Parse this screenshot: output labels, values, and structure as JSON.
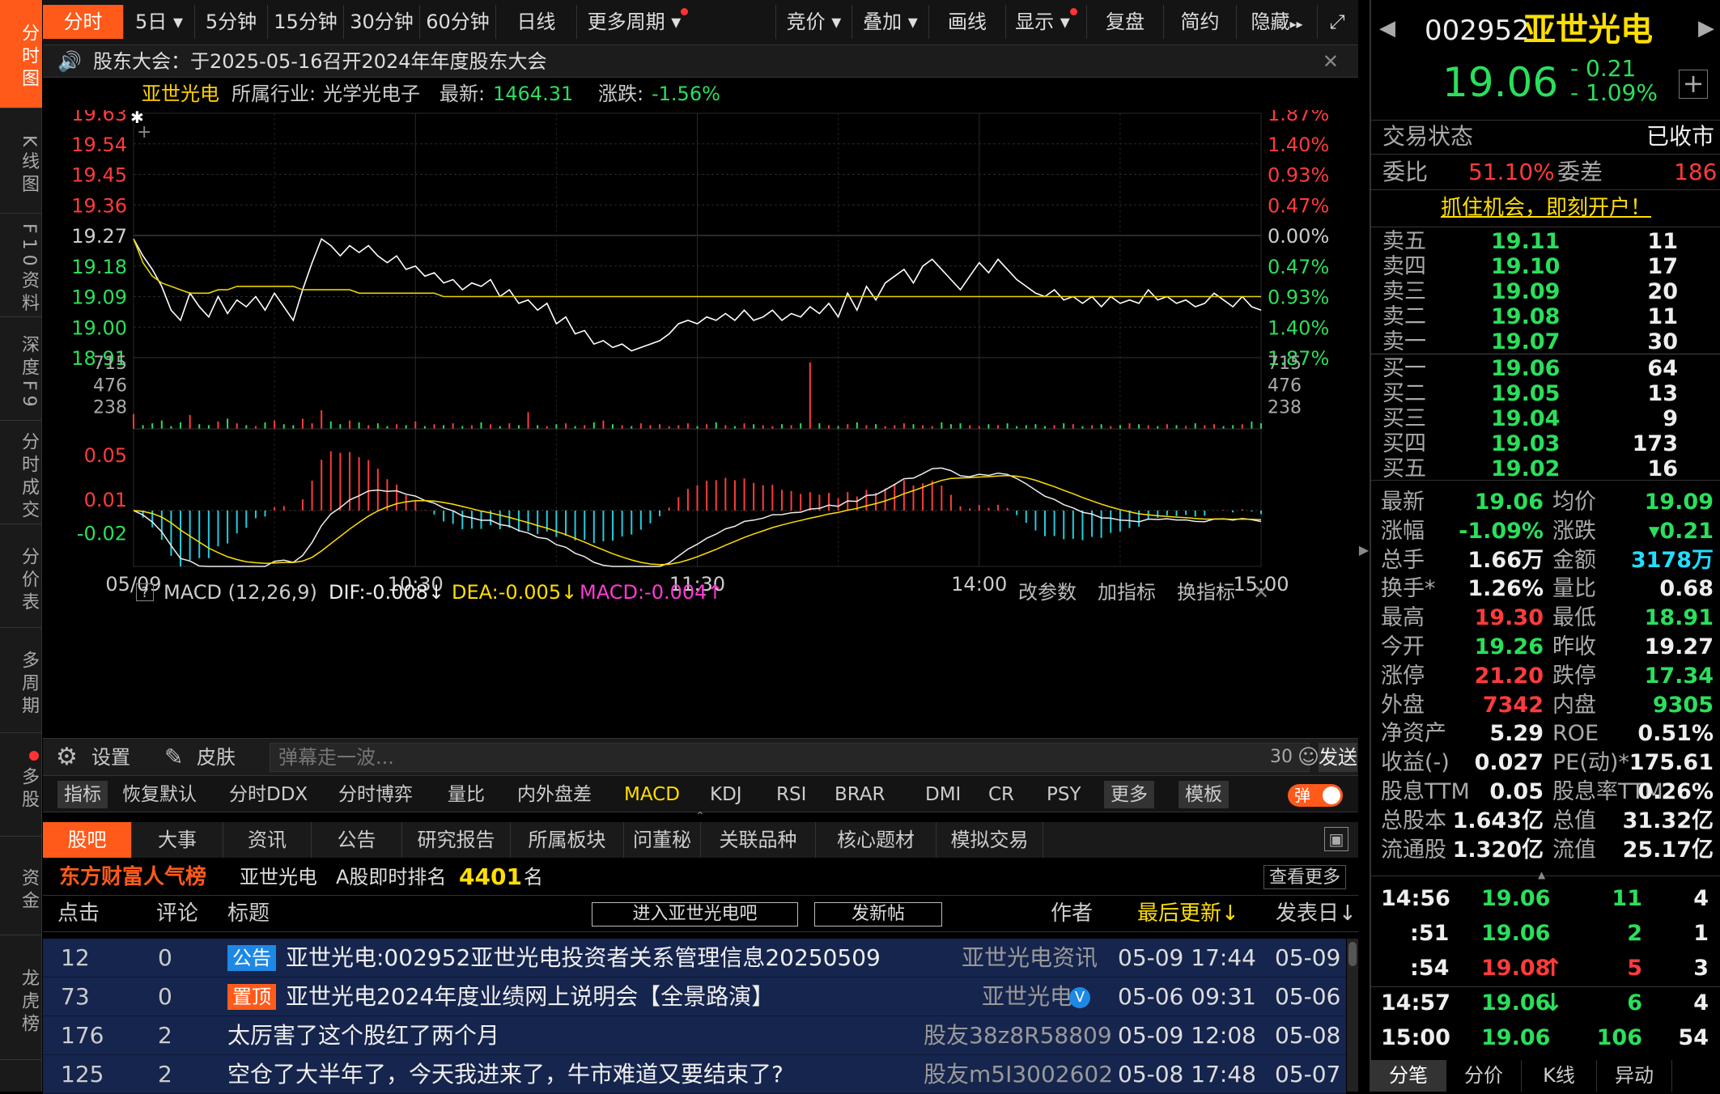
{
  "leftnav": [
    {
      "label": "分时图"
    },
    {
      "label": "K线图"
    },
    {
      "label": "F10资料"
    },
    {
      "label": "深度F9"
    },
    {
      "label": "分时成交"
    },
    {
      "label": "分价表"
    },
    {
      "label": "多周期"
    },
    {
      "label": "多股"
    },
    {
      "label": "资金"
    },
    {
      "label": "龙虎榜"
    }
  ],
  "toptabs": [
    "分时",
    "5日",
    "5分钟",
    "15分钟",
    "30分钟",
    "60分钟",
    "日线",
    "更多周期"
  ],
  "tools": [
    "竞价",
    "叠加",
    "画线",
    "显示",
    "复盘",
    "简约",
    "隐藏"
  ],
  "tool_icons": {
    "tabs_expand": "▾",
    "hide_arrow": "▸▸",
    "fullscreen": "⤢",
    "notice": "🔊",
    "close": "✕",
    "prev": "◀",
    "next": "▶",
    "add": "+",
    "help": "?",
    "gear": "⚙",
    "skin": "✎",
    "danmaku": "☺",
    "drag": "⌃",
    "collapse": "▶",
    "settings_box": "▣",
    "scroll": "▲",
    "dot": "●"
  },
  "notice": "股东大会：于2025-05-16召开2024年年度股东大会",
  "chart_header": {
    "name": "亚世光电",
    "industry_label": "所属行业:",
    "industry": "光学光电子",
    "latest_label": "最新:",
    "latest": "1464.31",
    "change_label": "涨跌:",
    "change": "-1.56%"
  },
  "macd_header": {
    "help": "?",
    "title": "MACD (12,26,9)",
    "dif": "DIF:-0.008↓",
    "dea": "DEA:-0.005↓",
    "macd": "MACD:-0.004↑",
    "b1": "改参数",
    "b2": "加指标",
    "b3": "换指标"
  },
  "bottombar": {
    "settings": "设置",
    "skin": "皮肤",
    "placeholder": "弹幕走一波...",
    "count": "30",
    "send": "发送"
  },
  "indicator_tabs": [
    "指标",
    "恢复默认",
    "分时DDX",
    "分时博弈",
    "量比",
    "内外盘差",
    "MACD",
    "KDJ",
    "RSI",
    "BRAR",
    "DMI",
    "CR",
    "PSY",
    "更多",
    "模板"
  ],
  "danmaku_toggle": "弹",
  "news_tabs": [
    "股吧",
    "大事",
    "资讯",
    "公告",
    "研究报告",
    "所属板块",
    "问董秘",
    "关联品种",
    "核心题材",
    "模拟交易"
  ],
  "rank": {
    "brand": "东方财富人气榜",
    "stock": "亚世光电",
    "label": "A股即时排名",
    "value": "4401",
    "unit": "名",
    "more": "查看更多"
  },
  "list_header": {
    "clicks": "点击",
    "comments": "评论",
    "title": "标题",
    "enter": "进入亚世光电吧",
    "post": "发新帖",
    "author": "作者",
    "updated": "最后更新↓",
    "published": "发表日↓"
  },
  "posts": [
    {
      "clicks": "12",
      "comments": "0",
      "tag": "公告",
      "tag_color": "#1e88e5",
      "title": "亚世光电:002952亚世光电投资者关系管理信息20250509",
      "author": "亚世光电资讯",
      "updated": "05-09 17:44",
      "published": "05-09"
    },
    {
      "clicks": "73",
      "comments": "0",
      "tag": "置顶",
      "tag_color": "#ff5a1a",
      "title": "亚世光电2024年度业绩网上说明会【全景路演】",
      "author": "亚世光电",
      "verified": "V",
      "updated": "05-06 09:31",
      "published": "05-06"
    },
    {
      "clicks": "176",
      "comments": "2",
      "tag": "",
      "title": "太厉害了这个股红了两个月",
      "author": "股友38z8R58809",
      "updated": "05-09 12:08",
      "published": "05-08"
    },
    {
      "clicks": "125",
      "comments": "2",
      "tag": "",
      "title": "空仓了大半年了，今天我进来了，牛市难道又要结束了?",
      "author": "股友m5I3002602",
      "updated": "05-08 17:48",
      "published": "05-07"
    }
  ],
  "quote": {
    "code": "002952",
    "name": "亚世光电",
    "price": "19.06",
    "chg": "- 0.21",
    "pct": "- 1.09%"
  },
  "status": {
    "label": "交易状态",
    "value": "已收市",
    "wb_label": "委比",
    "wb": "51.10%",
    "wc_label": "委差",
    "wc": "186",
    "promo": "抓住机会，即刻开户！"
  },
  "orderbook": [
    {
      "label": "卖五",
      "price": "19.11",
      "vol": "11"
    },
    {
      "label": "卖四",
      "price": "19.10",
      "vol": "17"
    },
    {
      "label": "卖三",
      "price": "19.09",
      "vol": "20"
    },
    {
      "label": "卖二",
      "price": "19.08",
      "vol": "11"
    },
    {
      "label": "卖一",
      "price": "19.07",
      "vol": "30"
    },
    {
      "label": "买一",
      "price": "19.06",
      "vol": "64"
    },
    {
      "label": "买二",
      "price": "19.05",
      "vol": "13"
    },
    {
      "label": "买三",
      "price": "19.04",
      "vol": "9"
    },
    {
      "label": "买四",
      "price": "19.03",
      "vol": "173"
    },
    {
      "label": "买五",
      "price": "19.02",
      "vol": "16"
    }
  ],
  "stats": [
    {
      "l1": "最新",
      "v1": "19.06",
      "c1": "green",
      "l2": "均价",
      "v2": "19.09",
      "c2": "green"
    },
    {
      "l1": "涨幅",
      "v1": "-1.09%",
      "c1": "green",
      "l2": "涨跌",
      "v2": "▾0.21",
      "c2": "green"
    },
    {
      "l1": "总手",
      "v1": "1.66万",
      "c1": "white",
      "l2": "金额",
      "v2": "3178万",
      "c2": "cyan"
    },
    {
      "l1": "换手*",
      "v1": "1.26%",
      "c1": "white",
      "l2": "量比",
      "v2": "0.68",
      "c2": "white"
    },
    {
      "l1": "最高",
      "v1": "19.30",
      "c1": "red",
      "l2": "最低",
      "v2": "18.91",
      "c2": "green"
    },
    {
      "l1": "今开",
      "v1": "19.26",
      "c1": "green",
      "l2": "昨收",
      "v2": "19.27",
      "c2": "white"
    },
    {
      "l1": "涨停",
      "v1": "21.20",
      "c1": "red",
      "l2": "跌停",
      "v2": "17.34",
      "c2": "green"
    },
    {
      "l1": "外盘",
      "v1": "7342",
      "c1": "red",
      "l2": "内盘",
      "v2": "9305",
      "c2": "green"
    },
    {
      "l1": "净资产",
      "v1": "5.29",
      "c1": "white",
      "l2": "ROE",
      "v2": "0.51%",
      "c2": "white"
    },
    {
      "l1": "收益(-)",
      "v1": "0.027",
      "c1": "white",
      "l2": "PE(动)*",
      "v2": "175.61",
      "c2": "white"
    },
    {
      "l1": "股息TTM",
      "v1": "0.05",
      "c1": "white",
      "l2": "股息率TTM",
      "v2": "0.26%",
      "c2": "white"
    },
    {
      "l1": "总股本",
      "v1": "1.643亿",
      "c1": "white",
      "l2": "总值",
      "v2": "31.32亿",
      "c2": "white"
    },
    {
      "l1": "流通股",
      "v1": "1.320亿",
      "c1": "white",
      "l2": "流值",
      "v2": "25.17亿",
      "c2": "white"
    }
  ],
  "ticks": [
    {
      "time": "14:56",
      "price": "19.06",
      "arrow": "",
      "vol": "11",
      "num": "4",
      "volcolor": "green"
    },
    {
      "time": ":51",
      "price": "19.06",
      "arrow": "",
      "vol": "2",
      "num": "1",
      "volcolor": "green"
    },
    {
      "time": ":54",
      "price": "19.08",
      "arrow": "↑",
      "vol": "5",
      "num": "3",
      "volcolor": "red"
    },
    {
      "time": "14:57",
      "price": "19.06",
      "arrow": "↓",
      "vol": "6",
      "num": "4",
      "volcolor": "green"
    },
    {
      "time": "15:00",
      "price": "19.06",
      "arrow": "",
      "vol": "106",
      "num": "54",
      "volcolor": "green"
    }
  ],
  "bottom_tabs": [
    "分笔",
    "分价",
    "K线",
    "异动"
  ],
  "chart_data": {
    "type": "line",
    "title": "",
    "x_ticks": [
      "05/09",
      "10:30",
      "11:30",
      "14:00",
      "15:00"
    ],
    "y_ticks": [
      "19.63",
      "19.54",
      "19.45",
      "19.36",
      "19.27",
      "19.18",
      "19.09",
      "19.00",
      "18.91"
    ],
    "y_ticks_pct": [
      "1.87%",
      "1.40%",
      "0.93%",
      "0.47%",
      "0.00%",
      "0.47%",
      "0.93%",
      "1.40%",
      "1.87%"
    ],
    "ylim": [
      18.91,
      19.63
    ],
    "prev_close": 19.27,
    "series": [
      {
        "values": [
          19.26,
          19.21,
          19.17,
          19.12,
          19.05,
          19.02,
          19.1,
          19.06,
          19.03,
          19.09,
          19.04,
          19.08,
          19.06,
          19.09,
          19.05,
          19.1,
          19.06,
          19.02,
          19.11,
          19.19,
          19.26,
          19.24,
          19.21,
          19.24,
          19.22,
          19.24,
          19.21,
          19.19,
          19.21,
          19.17,
          19.18,
          19.15,
          19.16,
          19.13,
          19.14,
          19.11,
          19.13,
          19.12,
          19.14,
          19.09,
          19.11,
          19.07,
          19.08,
          19.05,
          19.07,
          19.01,
          19.03,
          18.98,
          18.99,
          18.95,
          18.96,
          18.94,
          18.95,
          18.93,
          18.94,
          18.95,
          18.96,
          18.98,
          19.01,
          19.02,
          19.01,
          19.03,
          19.02,
          19.04,
          19.02,
          19.05,
          19.02,
          19.03,
          19.05,
          19.02,
          19.04,
          19.03,
          19.06,
          19.04,
          19.07,
          19.03,
          19.1,
          19.05,
          19.12,
          19.08,
          19.13,
          19.15,
          19.17,
          19.13,
          19.18,
          19.2,
          19.17,
          19.14,
          19.11,
          19.15,
          19.19,
          19.16,
          19.2,
          19.17,
          19.14,
          19.12,
          19.1,
          19.09,
          19.11,
          19.08,
          19.09,
          19.07,
          19.09,
          19.06,
          19.09,
          19.07,
          19.08,
          19.07,
          19.11,
          19.08,
          19.09,
          19.07,
          19.08,
          19.06,
          19.07,
          19.1,
          19.08,
          19.06,
          19.09,
          19.06,
          19.05
        ],
        "color": "#ffffff"
      },
      {
        "values": [
          19.26,
          19.19,
          19.15,
          19.13,
          19.12,
          19.11,
          19.1,
          19.1,
          19.1,
          19.11,
          19.11,
          19.12,
          19.12,
          19.12,
          19.12,
          19.12,
          19.12,
          19.12,
          19.11,
          19.11,
          19.11,
          19.11,
          19.11,
          19.11,
          19.1,
          19.1,
          19.1,
          19.1,
          19.1,
          19.1,
          19.1,
          19.1,
          19.1,
          19.09,
          19.09,
          19.09,
          19.09,
          19.09,
          19.09,
          19.09,
          19.09,
          19.09,
          19.09,
          19.09,
          19.09,
          19.09,
          19.09,
          19.09,
          19.09,
          19.09,
          19.09,
          19.09,
          19.09,
          19.09,
          19.09,
          19.09,
          19.09,
          19.09,
          19.09,
          19.09,
          19.09,
          19.09,
          19.09,
          19.09,
          19.09,
          19.09,
          19.09,
          19.09,
          19.09,
          19.09,
          19.09,
          19.09,
          19.09,
          19.09,
          19.09,
          19.09,
          19.09,
          19.09,
          19.09,
          19.09,
          19.09,
          19.09,
          19.09,
          19.09,
          19.09,
          19.09,
          19.09,
          19.09,
          19.09,
          19.09,
          19.09,
          19.09,
          19.09,
          19.09,
          19.09,
          19.09,
          19.09,
          19.09,
          19.09,
          19.09,
          19.09,
          19.09,
          19.09,
          19.09,
          19.09,
          19.09,
          19.09,
          19.09,
          19.09,
          19.09,
          19.09,
          19.09,
          19.09,
          19.09,
          19.09,
          19.09,
          19.09,
          19.09,
          19.09,
          19.09,
          19.09
        ],
        "color": "#e6d300"
      }
    ],
    "volume_ticks": [
      "715",
      "476",
      "238"
    ],
    "volume": [
      160,
      40,
      60,
      90,
      30,
      70,
      150,
      50,
      40,
      80,
      110,
      60,
      40,
      30,
      70,
      90,
      50,
      40,
      110,
      60,
      200,
      80,
      50,
      90,
      70,
      40,
      60,
      30,
      50,
      40,
      80,
      30,
      50,
      40,
      60,
      30,
      40,
      70,
      50,
      30,
      60,
      40,
      180,
      40,
      30,
      50,
      60,
      30,
      40,
      70,
      90,
      50,
      40,
      30,
      60,
      40,
      50,
      30,
      40,
      60,
      30,
      50,
      70,
      40,
      30,
      60,
      50,
      40,
      30,
      50,
      40,
      60,
      715,
      60,
      40,
      30,
      50,
      70,
      40,
      50,
      30,
      40,
      60,
      50,
      40,
      30,
      70,
      50,
      60,
      40,
      30,
      50,
      40,
      60,
      30,
      40,
      50,
      30,
      40,
      60,
      50,
      30,
      40,
      50,
      30,
      40,
      60,
      50,
      40,
      30,
      50,
      40,
      30,
      60,
      40,
      50,
      30,
      40,
      50,
      80,
      60
    ],
    "macd_ticks": [
      "0.05",
      "0.01",
      "-0.02"
    ],
    "macd_ylim": [
      -0.05,
      0.06
    ]
  }
}
